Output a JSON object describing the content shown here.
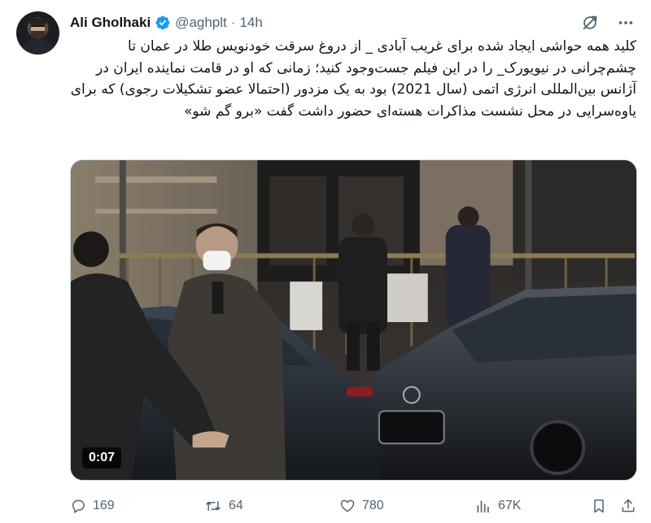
{
  "user": {
    "display_name": "Ali Gholhaki",
    "handle": "@aghplt",
    "separator": "·",
    "time": "14h",
    "verified": true
  },
  "tweet": {
    "text": "کلید همه حواشی ایجاد شده برای غریب آبادی _ از دروغ سرقت خودنویس طلا در عمان تا چشم‌چرانی در نیویورک_ را در این فیلم جست‌وجود کنید؛ زمانی که او در قامت نماینده ایران در آژانس بین‌المللی انرژی اتمی (سال 2021) بود به یک مزدور (احتمالا عضو تشکیلات رجوی) که برای یاوه‌سرایی در محل نشست مذاکرات هسته‌ای حضور داشت گفت «برو گم شو»"
  },
  "media": {
    "type": "video",
    "duration": "0:07"
  },
  "stats": {
    "replies": "169",
    "retweets": "64",
    "likes": "780",
    "views": "67K"
  },
  "icons": {
    "verified": "verified-badge-icon",
    "grok": "grok-icon",
    "more": "more-icon",
    "reply": "reply-icon",
    "retweet": "retweet-icon",
    "like": "heart-icon",
    "views": "views-icon",
    "bookmark": "bookmark-icon",
    "share": "share-icon"
  },
  "colors": {
    "text": "#0f1419",
    "secondary": "#536471",
    "verified": "#1d9bf0"
  }
}
